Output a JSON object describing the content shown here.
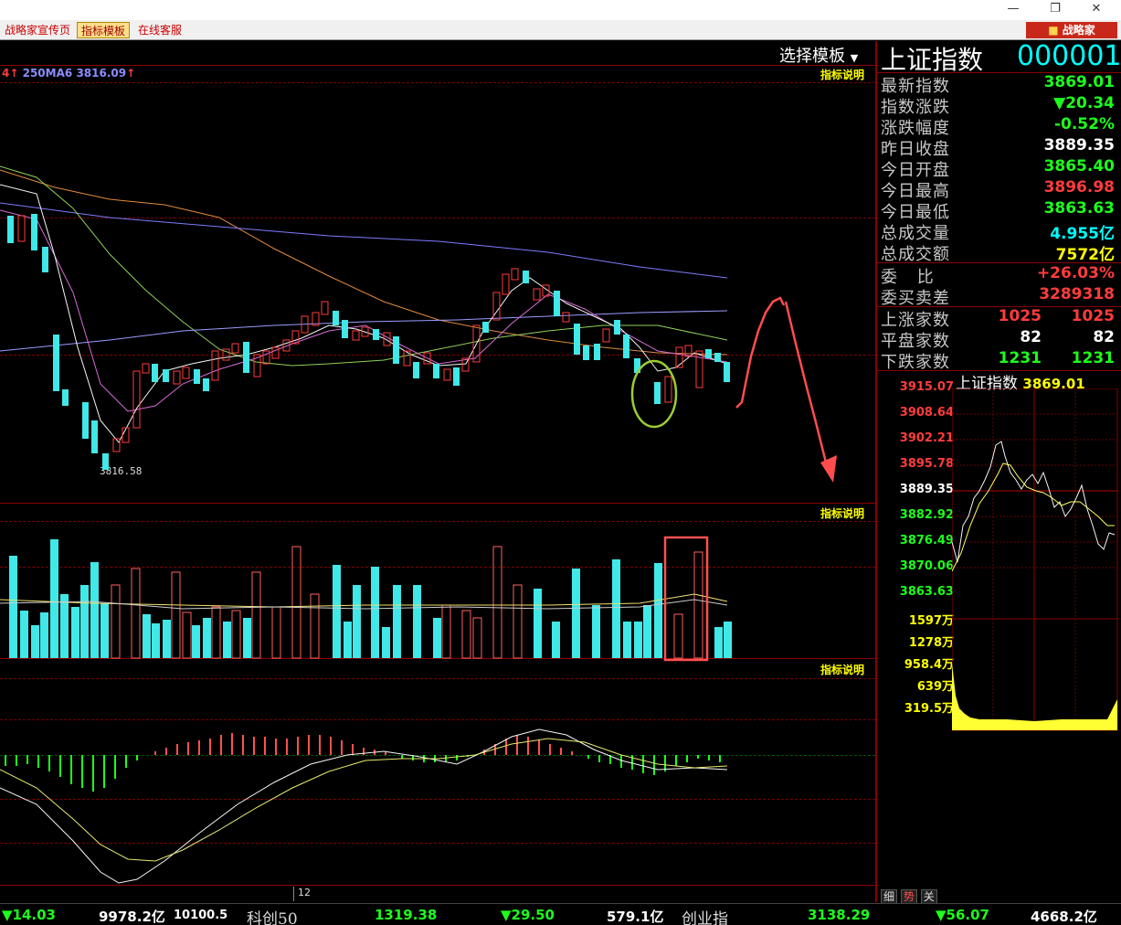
{
  "window": {
    "restore_icon": "restore-icon",
    "close_icon": "close-icon"
  },
  "tabs": [
    {
      "label": "战略家宣传页"
    },
    {
      "label": "指标模板"
    },
    {
      "label": "在线客服"
    }
  ],
  "brand": {
    "label": "战略家"
  },
  "template_selector": {
    "label": "选择模板"
  },
  "index": {
    "name": "上证指数",
    "code": "000001"
  },
  "main_chart": {
    "ma_legend": {
      "left_fragment": "4",
      "ma_label": "250MA6",
      "ma_value": "3816.09"
    },
    "help_label": "指标说明",
    "low_label": "3816.58"
  },
  "volume_panel": {
    "help_label": "指标说明"
  },
  "macd_panel": {
    "help_label": "指标说明"
  },
  "date_axis": {
    "label": "12"
  },
  "quote": [
    {
      "label": "最新指数",
      "value": "3869.01",
      "color": "#1cff1c"
    },
    {
      "label": "指数涨跌",
      "value": "▼20.34",
      "color": "#1cff1c"
    },
    {
      "label": "涨跌幅度",
      "value": "-0.52%",
      "color": "#1cff1c"
    },
    {
      "label": "昨日收盘",
      "value": "3889.35",
      "color": "#ffffff"
    },
    {
      "label": "今日开盘",
      "value": "3865.40",
      "color": "#1cff1c"
    },
    {
      "label": "今日最高",
      "value": "3896.98",
      "color": "#ff3c3c"
    },
    {
      "label": "今日最低",
      "value": "3863.63",
      "color": "#1cff1c"
    },
    {
      "label": "总成交量",
      "value": "4.955亿",
      "color": "#00ffff"
    },
    {
      "label": "总成交额",
      "value": "7572亿",
      "color": "#ffff00"
    }
  ],
  "ratio": [
    {
      "label": "委 比",
      "value": "+26.03%",
      "color": "#ff3c3c"
    },
    {
      "label": "委买卖差",
      "value": "3289318",
      "color": "#ff3c3c"
    }
  ],
  "breadth": [
    {
      "label": "上涨家数",
      "v1": "1025",
      "v2": "1025",
      "color": "#ff3c3c"
    },
    {
      "label": "平盘家数",
      "v1": "82",
      "v2": "82",
      "color": "#ffffff"
    },
    {
      "label": "下跌家数",
      "v1": "1231",
      "v2": "1231",
      "color": "#1cff1c"
    }
  ],
  "intraday": {
    "title": "上证指数",
    "last": "3869.01",
    "price_ticks": [
      {
        "v": "3915.07",
        "color": "#ff3c3c"
      },
      {
        "v": "3908.64",
        "color": "#ff3c3c"
      },
      {
        "v": "3902.21",
        "color": "#ff3c3c"
      },
      {
        "v": "3895.78",
        "color": "#ff3c3c"
      },
      {
        "v": "3889.35",
        "color": "#ffffff"
      },
      {
        "v": "3882.92",
        "color": "#1cff1c"
      },
      {
        "v": "3876.49",
        "color": "#1cff1c"
      },
      {
        "v": "3870.06",
        "color": "#1cff1c"
      },
      {
        "v": "3863.63",
        "color": "#1cff1c"
      }
    ],
    "vol_ticks": [
      "1597万",
      "1278万",
      "958.4万",
      "639万",
      "319.5万"
    ]
  },
  "side_tabs": [
    "细",
    "势",
    "关"
  ],
  "statusbar": {
    "sh_change": "▼14.03",
    "sh_amount": "9978.2亿",
    "sh_extra": "10100.5",
    "kc_name": "科创50",
    "kc_value": "1319.38",
    "kc_change": "▼29.50",
    "kc_amount": "579.1亿",
    "cy_name": "创业指",
    "cy_value": "3138.29",
    "cy_change": "▼56.07",
    "cy_amount": "4668.2亿"
  }
}
